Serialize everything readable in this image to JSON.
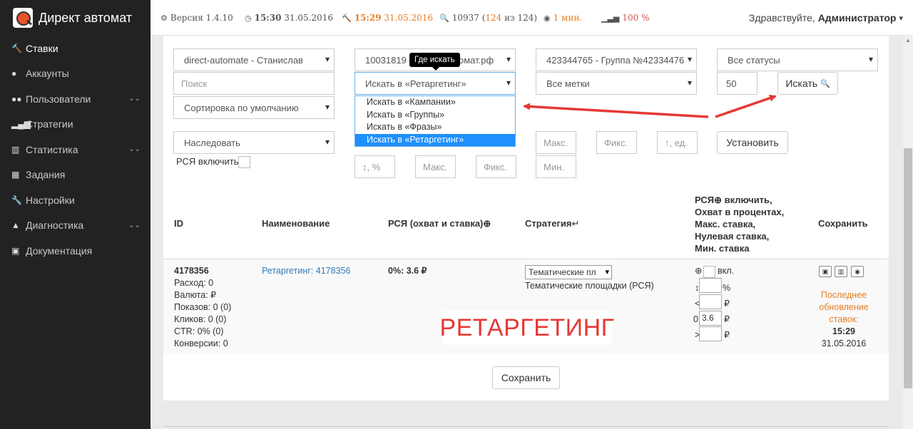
{
  "brand": {
    "name": "Директ автомат"
  },
  "status": {
    "version": "Версия 1.4.10",
    "time1": "15:30",
    "date1": "31.05.2016",
    "time2": "15:29",
    "date2": "31.05.2016",
    "count_total": "10937",
    "count_part1": "124",
    "count_sep": "из",
    "count_part2": "124",
    "interval": "1 мин.",
    "signal": "100 %"
  },
  "user": {
    "greeting": "Здравствуйте,",
    "name": "Администратор"
  },
  "sidebar": {
    "items": [
      {
        "label": "Ставки",
        "icon": "gavel-icon"
      },
      {
        "label": "Аккаунты",
        "icon": "user-icon"
      },
      {
        "label": "Пользователи",
        "icon": "users-icon"
      },
      {
        "label": "Стратегии",
        "icon": "signal-icon"
      },
      {
        "label": "Статистика",
        "icon": "bar-chart-icon"
      },
      {
        "label": "Задания",
        "icon": "calendar-icon"
      },
      {
        "label": "Настройки",
        "icon": "wrench-icon"
      },
      {
        "label": "Диагностика",
        "icon": "warning-icon"
      },
      {
        "label": "Документация",
        "icon": "image-icon"
      }
    ]
  },
  "filters": {
    "account": "direct-automate - Станислав",
    "campaign": "10031819",
    "campaign_suffix": "омат.рф",
    "group": "423344765 - Группа №42334476",
    "status": "Все статусы",
    "search_placeholder": "Поиск",
    "search_in": "Искать в «Ретаргетинг»",
    "labels": "Все метки",
    "limit": "50",
    "search_button": "Искать",
    "sort": "Сортировка по умолчанию",
    "tooltip": "Где искать",
    "search_options": [
      "Искать в «Кампании»",
      "Искать в «Группы»",
      "Искать в «Фразы»",
      "Искать в «Ретаргетинг»"
    ]
  },
  "bulk": {
    "strategy": "Наследовать",
    "rsya_enable": "РСЯ включить",
    "percent_ph": "↕, %",
    "max_ph": "Макс.",
    "max_ph2": "Макс.",
    "fix_ph": "Фикс.",
    "fix_ph2": "Фикс.",
    "unit_ph": "↑, ед.",
    "min_ph": "Мин.",
    "apply_button": "Установить"
  },
  "table": {
    "headers": {
      "id": "ID",
      "name": "Наименование",
      "rsya": "РСЯ (охват и ставка)",
      "strategy": "Стратегия",
      "rsya_block": [
        "включить,",
        "Охват в процентах,",
        "Макс. ставка,",
        "Нулевая ставка,",
        "Мин. ставка"
      ],
      "rsya_block_prefix": "РСЯ",
      "save": "Сохранить"
    },
    "row": {
      "id": "4178356",
      "stats": [
        "Расход: 0",
        "Валюта: ₽",
        "Показов: 0 (0)",
        "Кликов: 0 (0)",
        "CTR: 0% (0)",
        "Конверсии: 0"
      ],
      "name": "Ретаргетинг: 4178356",
      "rsya": "0%: 3.6 ₽",
      "strategy_select": "Тематические пл",
      "strategy_text": "Тематические площадки (РСЯ)",
      "on_label": "вкл.",
      "percent_unit": "%",
      "rub": "₽",
      "zero_prefix": "0",
      "zero_value": "3.6",
      "last_update": [
        "Последнее",
        "обновление",
        "ставок:"
      ],
      "update_time": "15:29",
      "update_date": "31.05.2016"
    }
  },
  "save_button": "Сохранить",
  "annotation": "РЕТАРГЕТИНГ",
  "colors": {
    "accent_orange": "#e67e22",
    "annotation_red": "#e53935",
    "arrow_red": "#e53935",
    "highlight": "#1e90ff"
  }
}
